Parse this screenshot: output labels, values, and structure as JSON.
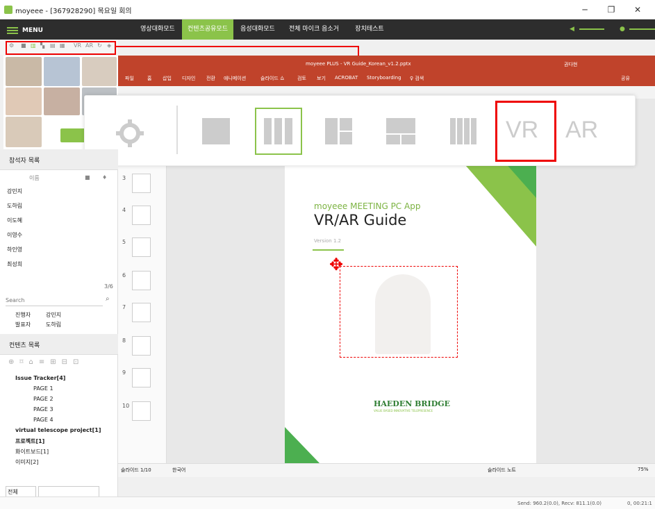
{
  "window": {
    "title": "moyeee - [367928290] 목요일 회의",
    "min": "─",
    "max": "❐",
    "close": "✕"
  },
  "menubar": {
    "menu_label": "MENU",
    "modes": [
      {
        "label": "영상대화모드"
      },
      {
        "label": "컨텐츠공유모드"
      },
      {
        "label": "음성대화모드"
      },
      {
        "label": "전체 마이크 음소거"
      },
      {
        "label": "장치테스트"
      }
    ]
  },
  "toolbar": {
    "items": [
      "⚙",
      "■",
      "▥",
      "▚",
      "▤",
      "▦",
      "VR",
      "AR",
      "↻",
      "◈"
    ]
  },
  "powerpoint": {
    "title": "moyeee PLUS - VR Guide_Korean_v1.2.pptx",
    "user": "권다현",
    "menu": [
      "파일",
      "홈",
      "삽입",
      "디자인",
      "전환",
      "애니메이션",
      "슬라이드 쇼",
      "검토",
      "보기",
      "ACROBAT",
      "Storyboarding",
      "♀ 검색"
    ],
    "share": "공유",
    "slide_numbers": [
      "3",
      "4",
      "5",
      "6",
      "7",
      "8",
      "9",
      "10"
    ],
    "status": {
      "slide": "슬라이드 1/10",
      "lang": "한국어",
      "notes": "슬라이드 노트",
      "zoom": "75%"
    }
  },
  "slide": {
    "app_label": "moyeee MEETING PC App",
    "title": "VR/AR Guide",
    "version": "Version 1.2",
    "brand": "HAEDEN BRIDGE",
    "brand_sub": "VALUE BASED INNOVATIVE TELEPRESENCE"
  },
  "zoom_panel": {
    "vr": "VR",
    "ar": "AR"
  },
  "participants": {
    "header": "참석자 목록",
    "col_name": "이름",
    "rows": [
      {
        "name": "강민지"
      },
      {
        "name": "도하림"
      },
      {
        "name": "이도혜"
      },
      {
        "name": "이영수"
      },
      {
        "name": "하인영"
      },
      {
        "name": "최성희"
      }
    ],
    "count": "3/6",
    "search_placeholder": "Search",
    "presenter_label": "진행자",
    "presenter_name": "강민지",
    "speaker_label": "발표자",
    "speaker_name": "도하림"
  },
  "contents": {
    "header": "컨텐츠 목록",
    "tree": [
      {
        "label": "Issue Tracker[4]",
        "bold": true,
        "indent": 0
      },
      {
        "label": "PAGE     1",
        "indent": 1
      },
      {
        "label": "PAGE     2",
        "indent": 1
      },
      {
        "label": "PAGE     3",
        "indent": 1
      },
      {
        "label": "PAGE     4",
        "indent": 1
      },
      {
        "label": "virtual telescope project[1]",
        "bold": true,
        "indent": 0
      },
      {
        "label": "프로젝트[1]",
        "bold": true,
        "indent": 0
      },
      {
        "label": "화이트보드[1]",
        "indent": 0
      },
      {
        "label": "이미지[2]",
        "indent": 0
      }
    ],
    "filter": "전체"
  },
  "statusbar": {
    "send": "Send: 960.2(0.0), Recv: 811.1(0.0)",
    "time": "0, 00:21:1"
  },
  "colors": {
    "accent": "#8bc34a",
    "highlight": "#e00000",
    "ppt": "#c0432b",
    "dark": "#2d2d2d"
  }
}
